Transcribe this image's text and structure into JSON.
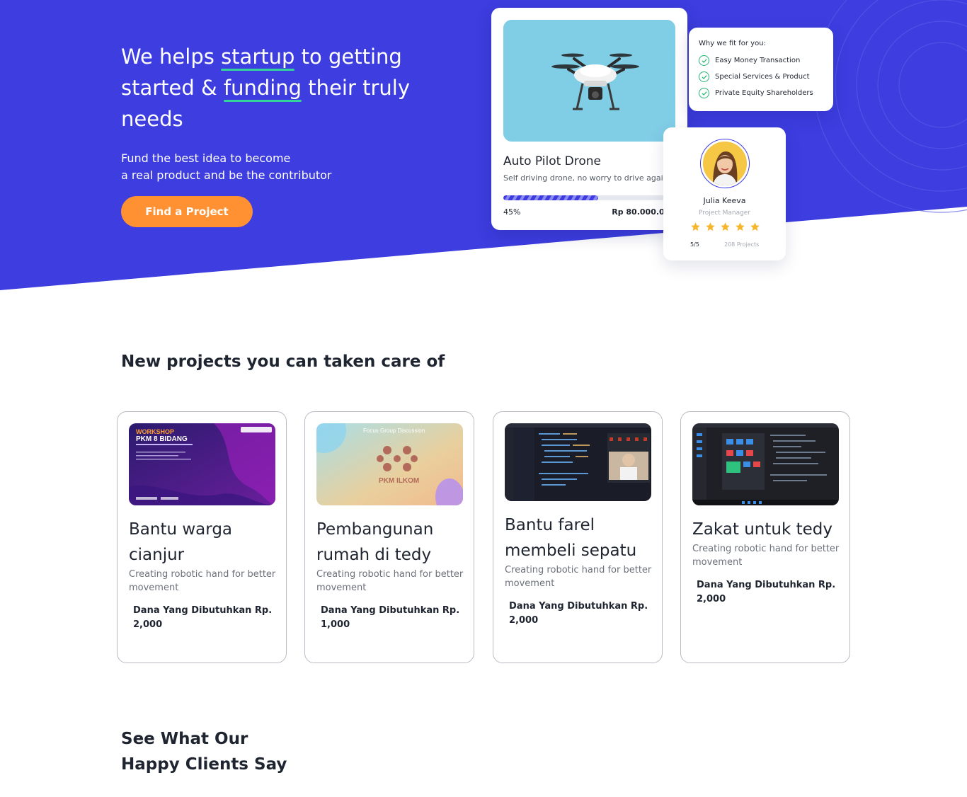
{
  "hero": {
    "title_part1": "We helps ",
    "title_highlight1": "startup",
    "title_part2": " to getting started & ",
    "title_highlight2": "funding",
    "title_part3": " their truly needs",
    "subtitle_line1": "Fund the best idea to become",
    "subtitle_line2": "a real product and be the contributor",
    "cta_label": "Find a Project",
    "colors": {
      "background": "#3d3de0",
      "cta": "#ff9133",
      "underline": "#34d399"
    }
  },
  "featured_project": {
    "image_icon": "drone-photo",
    "title": "Auto Pilot Drone",
    "description": "Self driving drone, no worry to drive again",
    "progress_percent": 55,
    "progress_label": "45%",
    "amount": "Rp 80.000.000"
  },
  "why_card": {
    "title": "Why we fit for you:",
    "items": [
      "Easy Money Transaction",
      "Special Services & Product",
      "Private Equity Shareholders"
    ]
  },
  "manager": {
    "name": "Julia Keeva",
    "role": "Project Manager",
    "stars": 5,
    "rating": "5/5",
    "projects": "208 Projects"
  },
  "new_projects": {
    "title": "New projects you can taken care of",
    "cards": [
      {
        "title": "Bantu warga cianjur",
        "description": "Creating robotic hand for better movement",
        "fund_label": "Dana Yang Dibutuhkan Rp.",
        "fund_value": "2,000",
        "thumb_text_1": "WORKSHOP",
        "thumb_text_2": "PKM 8 BIDANG"
      },
      {
        "title": "Pembangunan rumah di tedy",
        "description": "Creating robotic hand for better movement",
        "fund_label": "Dana Yang Dibutuhkan Rp.",
        "fund_value": "1,000",
        "thumb_text_1": "Focus Group Discussion",
        "thumb_text_2": "PKM ILKOM"
      },
      {
        "title": "Bantu farel membeli sepatu",
        "description": "Creating robotic hand for better movement",
        "fund_label": "Dana Yang Dibutuhkan Rp.",
        "fund_value": "2,000"
      },
      {
        "title": "Zakat untuk tedy",
        "description": "Creating robotic hand for better movement",
        "fund_label": "Dana Yang Dibutuhkan Rp.",
        "fund_value": "2,000"
      }
    ]
  },
  "testimonials": {
    "title_line1": "See What Our",
    "title_line2": "Happy Clients Say"
  }
}
